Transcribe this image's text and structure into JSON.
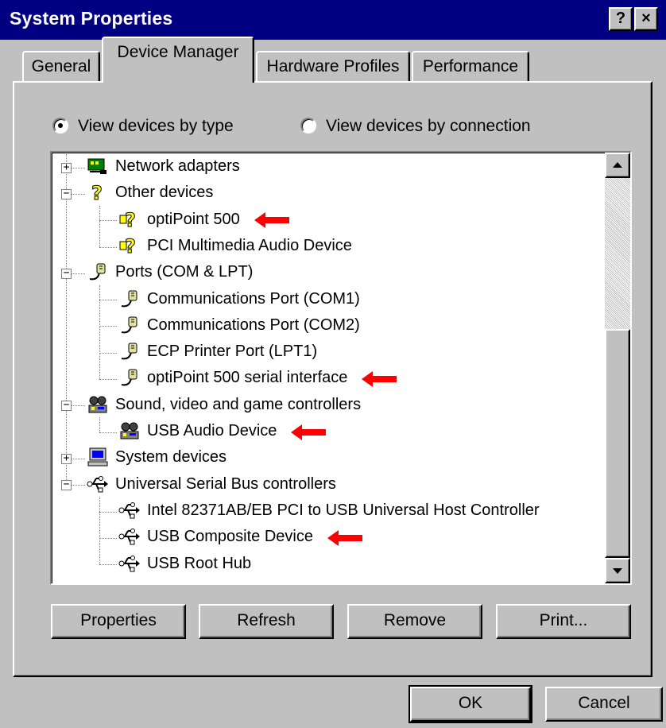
{
  "window": {
    "title": "System Properties",
    "help_label": "?",
    "close_label": "×"
  },
  "tabs": [
    {
      "label": "General",
      "active": false
    },
    {
      "label": "Device Manager",
      "active": true
    },
    {
      "label": "Hardware Profiles",
      "active": false
    },
    {
      "label": "Performance",
      "active": false
    }
  ],
  "view_options": {
    "by_type": {
      "label": "View devices by type",
      "checked": true
    },
    "by_connection": {
      "label": "View devices by connection",
      "checked": false
    }
  },
  "tree": [
    {
      "label": "Network adapters",
      "level": 0,
      "expanded": false,
      "icon": "network-adapter-icon"
    },
    {
      "label": "Other devices",
      "level": 0,
      "expanded": true,
      "icon": "question-mark-icon"
    },
    {
      "label": "optiPoint 500",
      "level": 1,
      "icon": "unknown-device-icon",
      "arrow": true
    },
    {
      "label": "PCI Multimedia Audio Device",
      "level": 1,
      "icon": "unknown-device-icon"
    },
    {
      "label": "Ports (COM & LPT)",
      "level": 0,
      "expanded": true,
      "icon": "port-icon"
    },
    {
      "label": "Communications Port (COM1)",
      "level": 1,
      "icon": "port-icon"
    },
    {
      "label": "Communications Port (COM2)",
      "level": 1,
      "icon": "port-icon"
    },
    {
      "label": "ECP Printer Port (LPT1)",
      "level": 1,
      "icon": "port-icon"
    },
    {
      "label": "optiPoint 500 serial interface",
      "level": 1,
      "icon": "port-icon",
      "arrow": true
    },
    {
      "label": "Sound, video and game controllers",
      "level": 0,
      "expanded": true,
      "icon": "sound-device-icon"
    },
    {
      "label": "USB Audio Device",
      "level": 1,
      "icon": "sound-device-icon",
      "arrow": true
    },
    {
      "label": "System devices",
      "level": 0,
      "expanded": false,
      "icon": "computer-icon"
    },
    {
      "label": "Universal Serial Bus controllers",
      "level": 0,
      "expanded": true,
      "icon": "usb-icon"
    },
    {
      "label": "Intel 82371AB/EB PCI to USB Universal Host Controller",
      "level": 1,
      "icon": "usb-icon"
    },
    {
      "label": "USB Composite Device",
      "level": 1,
      "icon": "usb-icon",
      "arrow": true
    },
    {
      "label": "USB Root Hub",
      "level": 1,
      "icon": "usb-icon"
    }
  ],
  "panel_buttons": {
    "properties": "Properties",
    "refresh": "Refresh",
    "remove": "Remove",
    "print": "Print..."
  },
  "dialog_buttons": {
    "ok": "OK",
    "cancel": "Cancel"
  },
  "colors": {
    "title_bar": "#000080",
    "window_face": "#c0c0c0",
    "annotation_arrow": "#ff0000"
  }
}
